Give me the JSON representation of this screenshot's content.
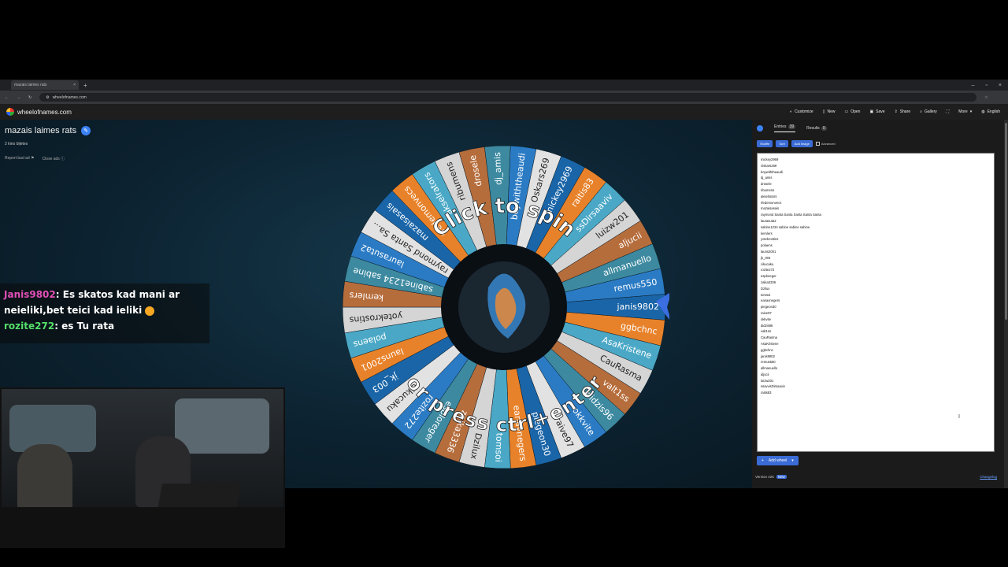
{
  "browser": {
    "tab_title": "mazais laimes rats",
    "tab_close": "×",
    "new_tab": "+",
    "url": "wheelofnames.com",
    "win_min": "–",
    "win_max": "▫",
    "win_close": "×"
  },
  "site": {
    "logo": "wheelofnames.com",
    "menu": [
      "Customize",
      "New",
      "Open",
      "Save",
      "Share",
      "Gallery",
      "More",
      "English"
    ],
    "menu_icons": [
      "palette-icon",
      "new-icon",
      "open-icon",
      "save-icon",
      "share-icon",
      "gallery-icon",
      "fullscreen-icon",
      "globe-icon"
    ]
  },
  "wheel": {
    "title": "mazais laimes rats",
    "subtitle": "2 kino biļetes",
    "report_ad": "Report bad ad",
    "close_ads": "Close ads",
    "prompt_top": "Click to spin",
    "prompt_bottom": "or press ctrl+enter",
    "segments": [
      "janis9802",
      "ggbchnc",
      "AsaKristene",
      "CauRasma",
      "valt1ss",
      "didzis96",
      "okkvite",
      "raive97",
      "piegeon30",
      "eanavnegers",
      "tomsoi",
      "Dzilux",
      "zaika3336",
      "esploreger",
      "rozite272",
      "cikucaku",
      "jk_003",
      "launs2001",
      "polaens",
      "yotekrostins",
      "kemlers",
      "sabine1234 sabine",
      "laurasuta2",
      "raymond Santa Sa...",
      "mazaisasais",
      "rfedemonvecs",
      "akselrators",
      "ribumens",
      "drosele",
      "dj_amis",
      "boywiththeaudi",
      "Oskars269",
      "mickey2969",
      "raitis83",
      "ssDirsaaviv",
      "luizw201",
      "aljucii",
      "allmanuello",
      "remus550"
    ],
    "colors": [
      "#1a65a8",
      "#e8822a",
      "#4aa8c6",
      "#d5d5d5",
      "#b66d3c",
      "#3d8aa0",
      "#2b7bc4",
      "#e2e2e2"
    ]
  },
  "chat": {
    "user1": "Janis9802",
    "msg1": ": Es skatos kad mani ar neieliki,bet teici kad ieliki",
    "user2": "rozite272",
    "msg2": ": es Tu rata"
  },
  "panel": {
    "tab_entries": "Entries",
    "entries_count": "39",
    "tab_results": "Results",
    "results_count": "0",
    "shuffle": "Shuffle",
    "sort": "Sort",
    "add_image": "Add image",
    "advanced": "Advanced",
    "entries": [
      "mickey2969",
      "Oskars269",
      "boywiththeaudi",
      "dj_amis",
      "drosele",
      "ribumens",
      "akselrators",
      "rfedemonvecs",
      "mazaisasais",
      "raymond Santa Santa Santa Santa Santa",
      "laurasuta2",
      "sabine1234 sabine sabine sabine",
      "kemlers",
      "yotekrostins",
      "polaens",
      "launs2001",
      "jk_003",
      "cikucaku",
      "rozite272",
      "esploreger",
      "zaika3336",
      "Dzilux",
      "tomsoi",
      "eanavnegers",
      "piegeon30",
      "raive97",
      "okkvite",
      "didzis96",
      "valt1ss",
      "CauRasma",
      "AsaKristene",
      "ggbchnc",
      "janis9802",
      "remus550",
      "allmanuello",
      "aljucii",
      "luizw201",
      "ssavvisDirsaaviv",
      "raitis83"
    ],
    "add_wheel": "Add wheel",
    "version": "Version 425",
    "new_badge": "New",
    "changelog": "Changelog"
  }
}
